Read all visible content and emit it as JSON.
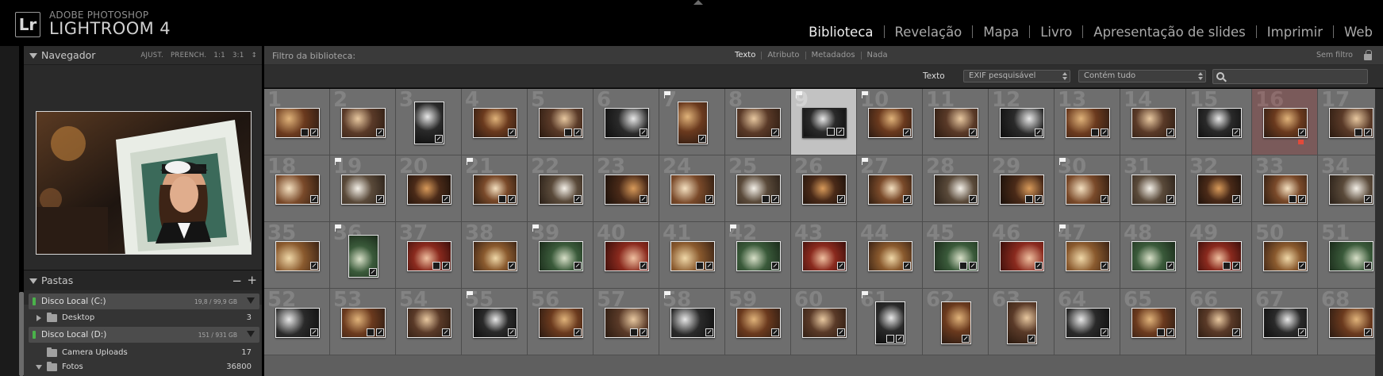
{
  "header": {
    "badge": "Lr",
    "brand_top": "ADOBE PHOTOSHOP",
    "brand_main": "LIGHTROOM 4",
    "modules": [
      "Biblioteca",
      "Revelação",
      "Mapa",
      "Livro",
      "Apresentação de slides",
      "Imprimir",
      "Web"
    ],
    "active_module": "Biblioteca"
  },
  "navigator": {
    "title": "Navegador",
    "options": [
      "AJUST.",
      "PREENCH.",
      "1:1",
      "3:1"
    ]
  },
  "folders": {
    "title": "Pastas",
    "volumes": [
      {
        "name": "Disco Local (C:)",
        "size": "19,8 / 99,9 GB",
        "items": [
          {
            "name": "Desktop",
            "count": "3"
          }
        ]
      },
      {
        "name": "Disco Local (D:)",
        "size": "151 / 931 GB",
        "items": [
          {
            "name": "Camera Uploads",
            "count": "17"
          },
          {
            "name": "Fotos",
            "count": "36800"
          }
        ]
      }
    ]
  },
  "filter": {
    "title": "Filtro da biblioteca:",
    "modes": [
      "Texto",
      "Atributo",
      "Metadados",
      "Nada"
    ],
    "active_mode": "Texto",
    "preset": "Sem filtro",
    "text_label": "Texto",
    "field_select": "EXIF pesquisável",
    "rule_select": "Contém tudo",
    "search_value": ""
  },
  "colors": {
    "accent_red": "#e24a3a",
    "selected_cell": "#c2c2c2",
    "volume_led": "#4ab34a"
  },
  "grid": {
    "cell_numbers": [
      [
        "1",
        "2",
        "3",
        "4",
        "5",
        "6",
        "7",
        "8",
        "9",
        "10",
        "11",
        "12",
        "13",
        "14",
        "15",
        "16",
        "17"
      ],
      [
        "18",
        "19",
        "20",
        "21",
        "22",
        "23",
        "24",
        "25",
        "26",
        "27",
        "28",
        "29",
        "30",
        "31",
        "32",
        "33",
        "34"
      ],
      [
        "35",
        "36",
        "37",
        "38",
        "39",
        "40",
        "41",
        "42",
        "43",
        "44",
        "45",
        "46",
        "47",
        "48",
        "49",
        "50",
        "51"
      ],
      [
        "52",
        "53",
        "54",
        "55",
        "56",
        "57",
        "58",
        "59",
        "60",
        "61",
        "62",
        "63",
        "64",
        "65",
        "66",
        "67",
        "68"
      ]
    ],
    "selected": [
      0,
      8
    ],
    "red_label": [
      0,
      15
    ],
    "flagged": [
      [
        0,
        6
      ],
      [
        0,
        8
      ],
      [
        0,
        9
      ],
      [
        1,
        1
      ],
      [
        1,
        3
      ],
      [
        1,
        9
      ],
      [
        1,
        12
      ],
      [
        2,
        1
      ],
      [
        2,
        4
      ],
      [
        2,
        7
      ],
      [
        2,
        12
      ],
      [
        3,
        3
      ],
      [
        3,
        6
      ],
      [
        3,
        9
      ]
    ],
    "portrait": [
      [
        0,
        2
      ],
      [
        0,
        6
      ],
      [
        2,
        1
      ],
      [
        3,
        9
      ],
      [
        3,
        10
      ],
      [
        3,
        11
      ]
    ]
  }
}
